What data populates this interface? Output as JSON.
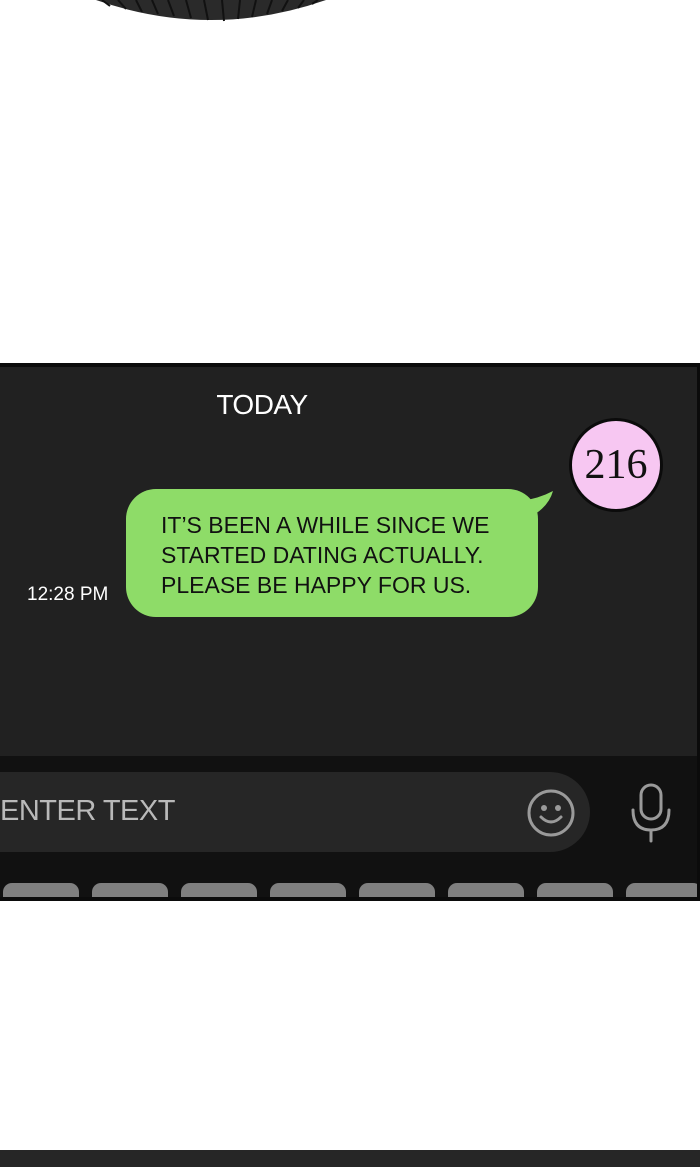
{
  "conversation": {
    "date_label": "TODAY",
    "message": {
      "lines": [
        "IT’S BEEN A WHILE SINCE WE",
        "STARTED DATING ACTUALLY.",
        "PLEASE BE HAPPY FOR US."
      ],
      "time": "12:28 PM"
    }
  },
  "badge": {
    "value": "216"
  },
  "composer": {
    "placeholder": "ENTER TEXT",
    "emoji_icon": "smiley-face-icon",
    "mic_icon": "microphone-icon"
  },
  "keyboard": {
    "visible_key_count": "8"
  },
  "colors": {
    "panel_bg": "#212121",
    "bubble": "#8edc68",
    "badge": "#f7c7f2",
    "composer_bg": "#111111",
    "pill_bg": "#262626"
  }
}
